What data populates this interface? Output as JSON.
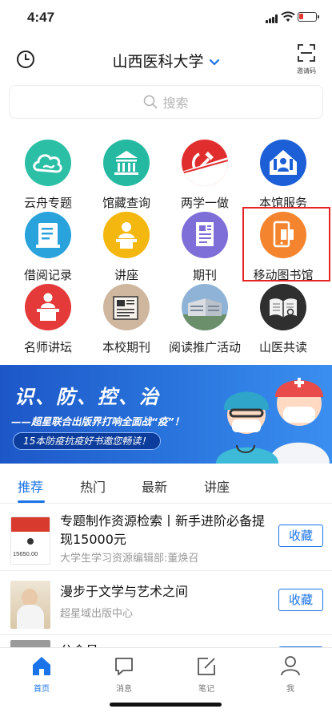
{
  "status": {
    "time": "4:47"
  },
  "header": {
    "title": "山西医科大学",
    "invite_label": "邀请码"
  },
  "search": {
    "placeholder": "搜索"
  },
  "grid": [
    {
      "label": "云舟专题",
      "icon": "cloud-icon",
      "color": "#2bbfa5"
    },
    {
      "label": "馆藏查询",
      "icon": "library-building-icon",
      "color": "#25b9a2"
    },
    {
      "label": "两学一做",
      "icon": "hammer-sickle-icon",
      "color": "#e02e2e"
    },
    {
      "label": "本馆服务",
      "icon": "home-service-icon",
      "color": "#1c5fd6"
    },
    {
      "label": "借阅记录",
      "icon": "borrow-record-icon",
      "color": "#2aa2dc"
    },
    {
      "label": "讲座",
      "icon": "lecture-icon",
      "color": "#f4b70f"
    },
    {
      "label": "期刊",
      "icon": "journal-icon",
      "color": "#7d6ed8"
    },
    {
      "label": "移动图书馆",
      "icon": "mobile-library-icon",
      "color": "#f5842f"
    },
    {
      "label": "名师讲坛",
      "icon": "podium-icon",
      "color": "#e53a3a"
    },
    {
      "label": "本校期刊",
      "icon": "newspaper-icon",
      "color": "#cfb79f"
    },
    {
      "label": "阅读推广活动",
      "icon": "building-photo-icon",
      "color": "#5a7fa8"
    },
    {
      "label": "山医共读",
      "icon": "open-book-icon",
      "color": "#2f2f2f"
    }
  ],
  "banner": {
    "headline": "识、防、控、治",
    "subline": "——超星联合出版界打响全面战“疫”！",
    "pill": "15本防疫抗疫好书邀您畅读！"
  },
  "tabs": [
    {
      "label": "推荐",
      "active": true
    },
    {
      "label": "热门",
      "active": false
    },
    {
      "label": "最新",
      "active": false
    },
    {
      "label": "讲座",
      "active": false
    }
  ],
  "list": [
    {
      "title": "专题制作资源检索丨新手进阶必备提现15000元",
      "subtitle": "大学生学习资源编辑部:董焕召",
      "action": "收藏",
      "thumb_text": "15650.00"
    },
    {
      "title": "漫步于文学与艺术之间",
      "subtitle": "超星域出版中心",
      "action": "收藏"
    },
    {
      "title": "分会员",
      "subtitle": "",
      "action": "收藏"
    }
  ],
  "bottom_nav": [
    {
      "label": "首页",
      "icon": "home-icon",
      "active": true
    },
    {
      "label": "消息",
      "icon": "message-icon",
      "active": false
    },
    {
      "label": "笔记",
      "icon": "note-icon",
      "active": false
    },
    {
      "label": "我",
      "icon": "person-icon",
      "active": false
    }
  ],
  "colors": {
    "accent": "#1a73e8",
    "highlight_border": "#e52424"
  }
}
